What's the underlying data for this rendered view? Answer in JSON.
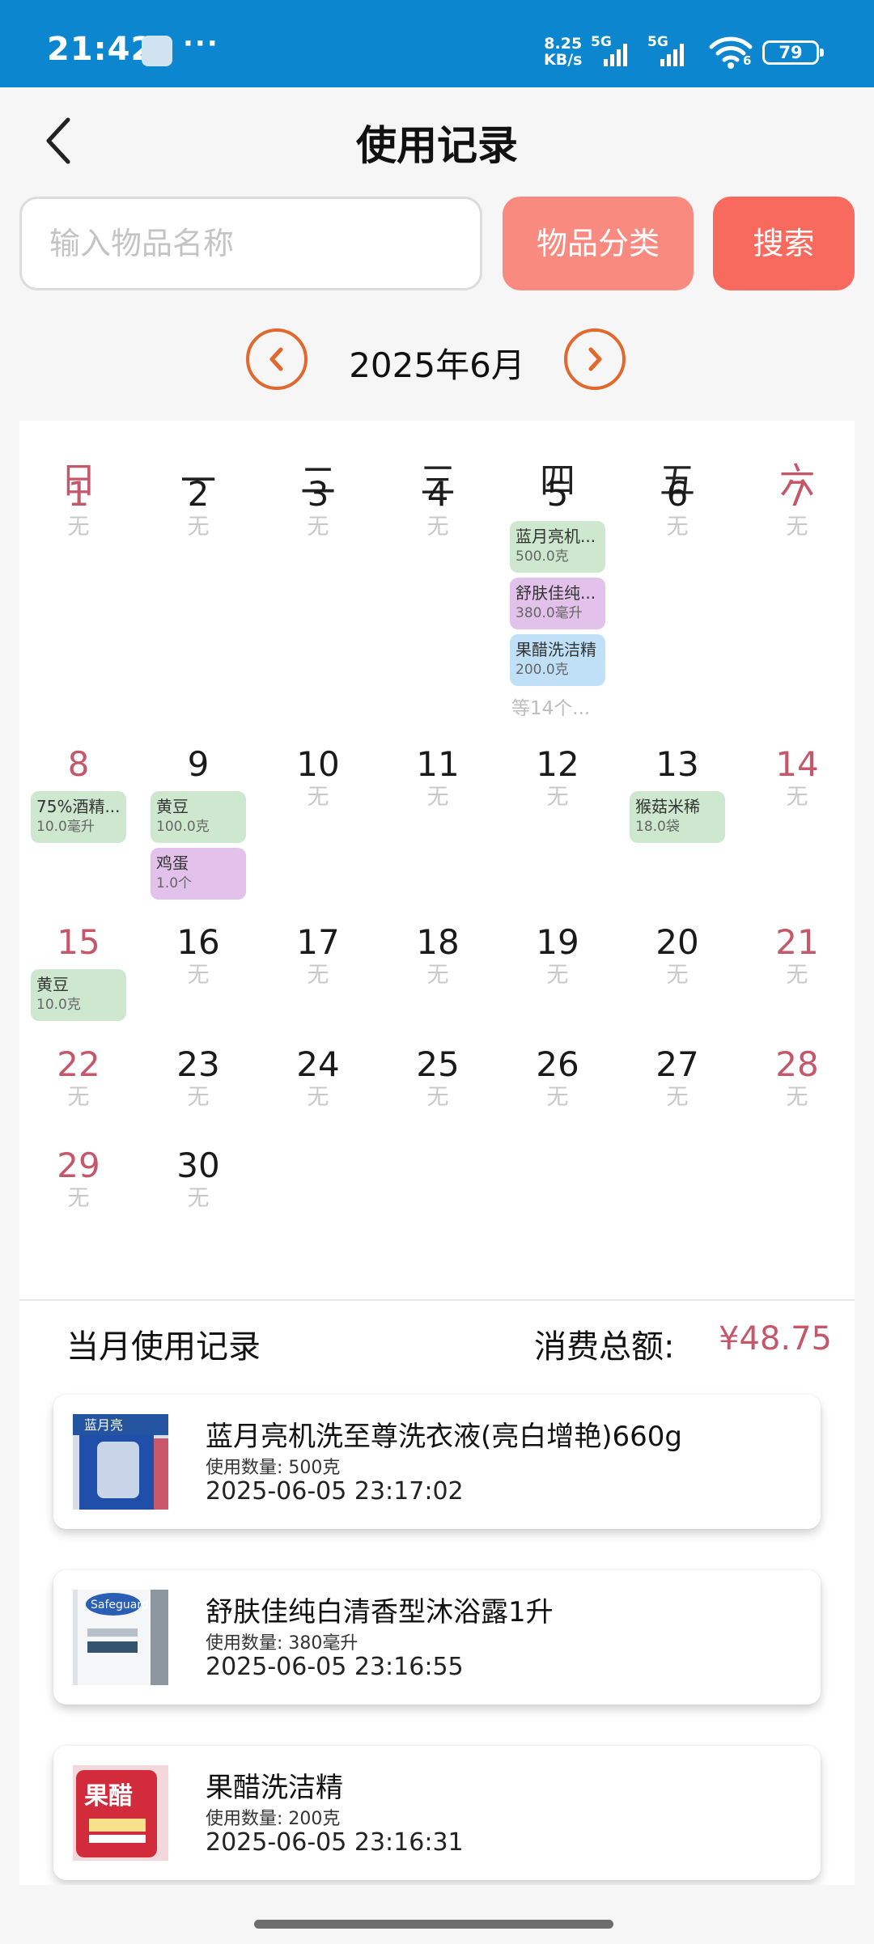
{
  "status_bar": {
    "time": "21:42",
    "more": "···",
    "net_speed_value": "8.25",
    "net_speed_unit": "KB/s",
    "signal_1": "5G",
    "signal_2": "5G",
    "wifi_sub": "6",
    "battery": "79"
  },
  "header": {
    "title": "使用记录"
  },
  "search": {
    "placeholder": "输入物品名称",
    "value": "",
    "category_label": "物品分类",
    "search_label": "搜索"
  },
  "calendar": {
    "month_label": "2025年6月",
    "weekdays": [
      "日",
      "一",
      "二",
      "三",
      "四",
      "五",
      "六"
    ],
    "empty_label": "无",
    "weeks": [
      {
        "days": [
          {
            "num": "1"
          },
          {
            "num": "2"
          },
          {
            "num": "3"
          },
          {
            "num": "4"
          },
          {
            "num": "5",
            "entries": [
              {
                "name": "蓝月亮机...",
                "qty": "500.0克",
                "color": "#cde8cf"
              },
              {
                "name": "舒肤佳纯...",
                "qty": "380.0毫升",
                "color": "#e2c2ea"
              },
              {
                "name": "果醋洗洁精",
                "qty": "200.0克",
                "color": "#bfe0f7"
              }
            ],
            "more": "等14个..."
          },
          {
            "num": "6"
          },
          {
            "num": "7"
          }
        ]
      },
      {
        "days": [
          {
            "num": "8",
            "entries": [
              {
                "name": "75%酒精...",
                "qty": "10.0毫升",
                "color": "#cde8cf"
              }
            ]
          },
          {
            "num": "9",
            "entries": [
              {
                "name": "黄豆",
                "qty": "100.0克",
                "color": "#cde8cf"
              },
              {
                "name": "鸡蛋",
                "qty": "1.0个",
                "color": "#e2c2ea"
              }
            ]
          },
          {
            "num": "10"
          },
          {
            "num": "11"
          },
          {
            "num": "12"
          },
          {
            "num": "13",
            "entries": [
              {
                "name": "猴菇米稀",
                "qty": "18.0袋",
                "color": "#cde8cf"
              }
            ]
          },
          {
            "num": "14"
          }
        ]
      },
      {
        "days": [
          {
            "num": "15",
            "entries": [
              {
                "name": "黄豆",
                "qty": "10.0克",
                "color": "#cde8cf"
              }
            ]
          },
          {
            "num": "16"
          },
          {
            "num": "17"
          },
          {
            "num": "18"
          },
          {
            "num": "19"
          },
          {
            "num": "20"
          },
          {
            "num": "21"
          }
        ]
      },
      {
        "days": [
          {
            "num": "22"
          },
          {
            "num": "23"
          },
          {
            "num": "24"
          },
          {
            "num": "25"
          },
          {
            "num": "26"
          },
          {
            "num": "27"
          },
          {
            "num": "28"
          }
        ]
      },
      {
        "days": [
          {
            "num": "29"
          },
          {
            "num": "30"
          }
        ]
      }
    ]
  },
  "monthly": {
    "title": "当月使用记录",
    "total_label": "消费总额:",
    "total_value": "¥48.75",
    "records": [
      {
        "name": "蓝月亮机洗至尊洗衣液(亮白增艳)660g",
        "qty": "使用数量: 500克",
        "time": "2025-06-05 23:17:02",
        "thumb_text": "蓝月亮"
      },
      {
        "name": "舒肤佳纯白清香型沐浴露1升",
        "qty": "使用数量: 380毫升",
        "time": "2025-06-05 23:16:55",
        "thumb_text": "Safeguard"
      },
      {
        "name": "果醋洗洁精",
        "qty": "使用数量: 200克",
        "time": "2025-06-05 23:16:31",
        "thumb_text": "果醋"
      }
    ]
  },
  "colors": {
    "status_bar": "#0b86cf",
    "accent_orange": "#e2682d",
    "category_btn": "#f98a80",
    "search_btn": "#f86a5e",
    "weekend_red": "#c5576a"
  }
}
